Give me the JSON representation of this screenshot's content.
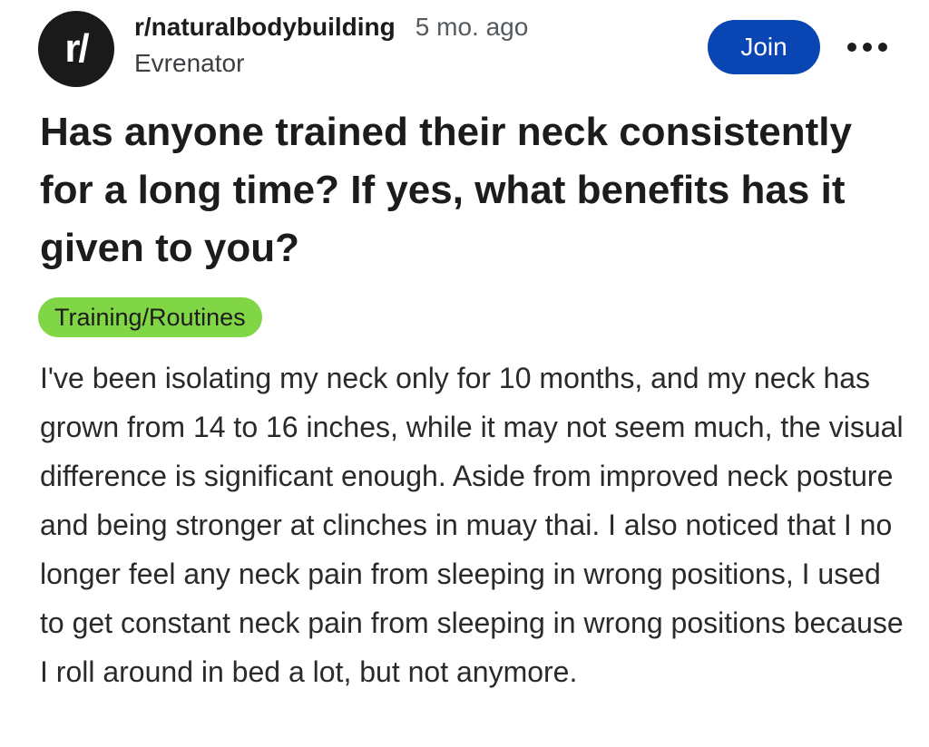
{
  "post": {
    "subreddit_avatar_text": "r/",
    "subreddit": "r/naturalbodybuilding",
    "time_ago": "5 mo. ago",
    "author": "Evrenator",
    "join_label": "Join",
    "more_icon": "more-horizontal-icon",
    "title": "Has anyone trained their neck consistently for a long time? If yes, what benefits has it given to you?",
    "flair": {
      "label": "Training/Routines",
      "color": "#80d645"
    },
    "body": "I've been isolating my neck only for 10 months, and my neck has grown from 14 to 16 inches, while it may not seem much, the visual difference is significant enough. Aside from improved neck posture and being stronger at clinches in muay thai. I also noticed that I no longer feel any neck pain from sleeping in wrong positions, I used to get constant neck pain from sleeping in wrong positions because I roll around in bed a lot, but not anymore."
  },
  "colors": {
    "join_button": "#0a46b3",
    "avatar_bg": "#1a1a1b",
    "text": "#1c1c1c",
    "muted_text": "#555a5e"
  }
}
